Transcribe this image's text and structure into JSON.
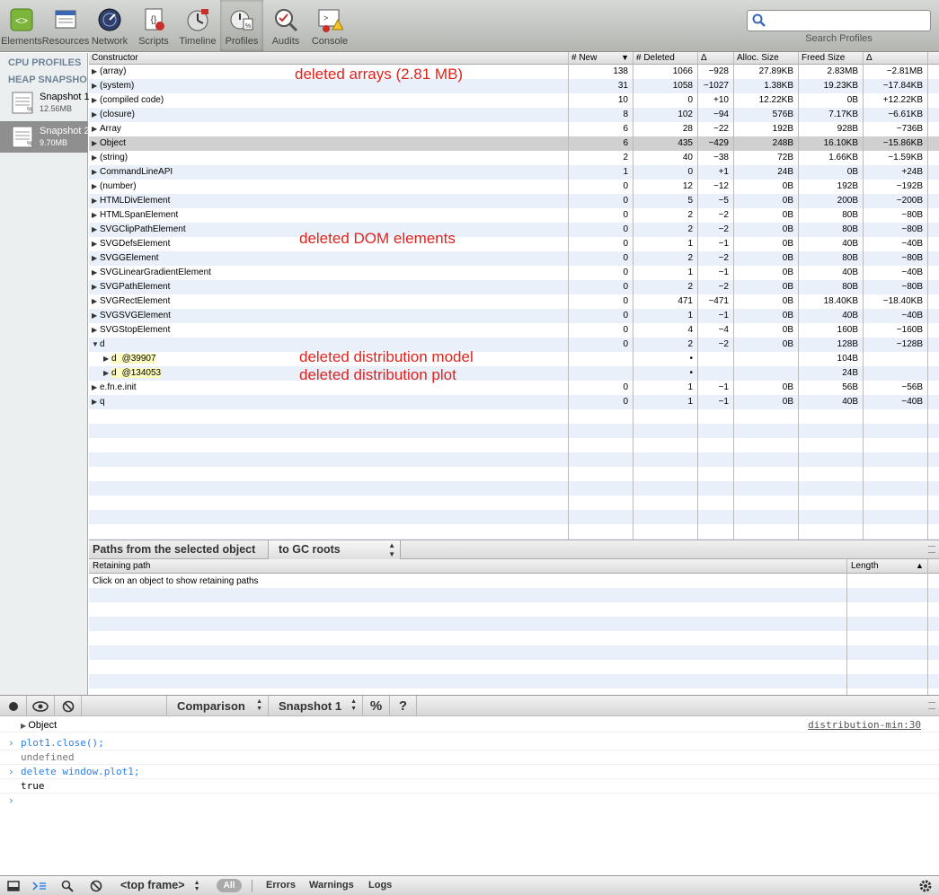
{
  "toolbar": {
    "items": [
      {
        "label": "Elements",
        "icon": "elements-icon"
      },
      {
        "label": "Resources",
        "icon": "resources-icon"
      },
      {
        "label": "Network",
        "icon": "network-icon"
      },
      {
        "label": "Scripts",
        "icon": "scripts-icon"
      },
      {
        "label": "Timeline",
        "icon": "timeline-icon"
      },
      {
        "label": "Profiles",
        "icon": "profiles-icon",
        "selected": true
      },
      {
        "label": "Audits",
        "icon": "audits-icon"
      },
      {
        "label": "Console",
        "icon": "console-icon"
      }
    ],
    "search": {
      "value": "",
      "label": "Search Profiles"
    }
  },
  "sidebar": {
    "cpu_profiles": "CPU PROFILES",
    "heap_snapshots": "HEAP SNAPSHOTS",
    "snapshots": [
      {
        "title": "Snapshot 1",
        "size": "12.56MB"
      },
      {
        "title": "Snapshot 2",
        "size": "9.70MB",
        "selected": true
      }
    ]
  },
  "grid": {
    "headers": [
      "Constructor",
      "# New",
      "# Deleted",
      "Δ",
      "Alloc. Size",
      "Freed Size",
      "Δ"
    ],
    "rows": [
      {
        "name": "(array)",
        "new": "138",
        "deleted": "1066",
        "delta": "−928",
        "alloc": "27.89KB",
        "freed": "2.83MB",
        "sdelta": "−2.81MB",
        "tri": "▶"
      },
      {
        "name": "(system)",
        "new": "31",
        "deleted": "1058",
        "delta": "−1027",
        "alloc": "1.38KB",
        "freed": "19.23KB",
        "sdelta": "−17.84KB",
        "tri": "▶"
      },
      {
        "name": "(compiled code)",
        "new": "10",
        "deleted": "0",
        "delta": "+10",
        "alloc": "12.22KB",
        "freed": "0B",
        "sdelta": "+12.22KB",
        "tri": "▶"
      },
      {
        "name": "(closure)",
        "new": "8",
        "deleted": "102",
        "delta": "−94",
        "alloc": "576B",
        "freed": "7.17KB",
        "sdelta": "−6.61KB",
        "tri": "▶"
      },
      {
        "name": "Array",
        "new": "6",
        "deleted": "28",
        "delta": "−22",
        "alloc": "192B",
        "freed": "928B",
        "sdelta": "−736B",
        "tri": "▶"
      },
      {
        "name": "Object",
        "new": "6",
        "deleted": "435",
        "delta": "−429",
        "alloc": "248B",
        "freed": "16.10KB",
        "sdelta": "−15.86KB",
        "tri": "▶",
        "selected": true
      },
      {
        "name": "(string)",
        "new": "2",
        "deleted": "40",
        "delta": "−38",
        "alloc": "72B",
        "freed": "1.66KB",
        "sdelta": "−1.59KB",
        "tri": "▶"
      },
      {
        "name": "CommandLineAPI",
        "new": "1",
        "deleted": "0",
        "delta": "+1",
        "alloc": "24B",
        "freed": "0B",
        "sdelta": "+24B",
        "tri": "▶"
      },
      {
        "name": "(number)",
        "new": "0",
        "deleted": "12",
        "delta": "−12",
        "alloc": "0B",
        "freed": "192B",
        "sdelta": "−192B",
        "tri": "▶"
      },
      {
        "name": "HTMLDivElement",
        "new": "0",
        "deleted": "5",
        "delta": "−5",
        "alloc": "0B",
        "freed": "200B",
        "sdelta": "−200B",
        "tri": "▶"
      },
      {
        "name": "HTMLSpanElement",
        "new": "0",
        "deleted": "2",
        "delta": "−2",
        "alloc": "0B",
        "freed": "80B",
        "sdelta": "−80B",
        "tri": "▶"
      },
      {
        "name": "SVGClipPathElement",
        "new": "0",
        "deleted": "2",
        "delta": "−2",
        "alloc": "0B",
        "freed": "80B",
        "sdelta": "−80B",
        "tri": "▶"
      },
      {
        "name": "SVGDefsElement",
        "new": "0",
        "deleted": "1",
        "delta": "−1",
        "alloc": "0B",
        "freed": "40B",
        "sdelta": "−40B",
        "tri": "▶"
      },
      {
        "name": "SVGGElement",
        "new": "0",
        "deleted": "2",
        "delta": "−2",
        "alloc": "0B",
        "freed": "80B",
        "sdelta": "−80B",
        "tri": "▶"
      },
      {
        "name": "SVGLinearGradientElement",
        "new": "0",
        "deleted": "1",
        "delta": "−1",
        "alloc": "0B",
        "freed": "40B",
        "sdelta": "−40B",
        "tri": "▶"
      },
      {
        "name": "SVGPathElement",
        "new": "0",
        "deleted": "2",
        "delta": "−2",
        "alloc": "0B",
        "freed": "80B",
        "sdelta": "−80B",
        "tri": "▶"
      },
      {
        "name": "SVGRectElement",
        "new": "0",
        "deleted": "471",
        "delta": "−471",
        "alloc": "0B",
        "freed": "18.40KB",
        "sdelta": "−18.40KB",
        "tri": "▶"
      },
      {
        "name": "SVGSVGElement",
        "new": "0",
        "deleted": "1",
        "delta": "−1",
        "alloc": "0B",
        "freed": "40B",
        "sdelta": "−40B",
        "tri": "▶"
      },
      {
        "name": "SVGStopElement",
        "new": "0",
        "deleted": "4",
        "delta": "−4",
        "alloc": "0B",
        "freed": "160B",
        "sdelta": "−160B",
        "tri": "▶"
      },
      {
        "name": "d",
        "new": "0",
        "deleted": "2",
        "delta": "−2",
        "alloc": "0B",
        "freed": "128B",
        "sdelta": "−128B",
        "tri": "▼"
      },
      {
        "name": "d",
        "addr": "@39907",
        "new": "",
        "deleted": "•",
        "delta": "",
        "alloc": "",
        "freed": "104B",
        "sdelta": "",
        "tri": "▶",
        "child": true
      },
      {
        "name": "d",
        "addr": "@134053",
        "new": "",
        "deleted": "•",
        "delta": "",
        "alloc": "",
        "freed": "24B",
        "sdelta": "",
        "tri": "▶",
        "child": true
      },
      {
        "name": "e.fn.e.init",
        "new": "0",
        "deleted": "1",
        "delta": "−1",
        "alloc": "0B",
        "freed": "56B",
        "sdelta": "−56B",
        "tri": "▶"
      },
      {
        "name": "q",
        "new": "0",
        "deleted": "1",
        "delta": "−1",
        "alloc": "0B",
        "freed": "40B",
        "sdelta": "−40B",
        "tri": "▶"
      }
    ]
  },
  "annotations": {
    "arrays": "deleted arrays (2.81 MB)",
    "dom": "deleted DOM elements",
    "model": "deleted distribution model",
    "plot": "deleted distribution plot",
    "color": "#e0231f"
  },
  "retaining": {
    "title": "Paths from the selected object",
    "select": "to GC roots",
    "col_path": "Retaining path",
    "col_length": "Length",
    "hint": "Click on an object to show retaining paths"
  },
  "statusbar": {
    "comparison": "Comparison",
    "snapshot": "Snapshot 1",
    "percent": "%",
    "help": "?"
  },
  "console": {
    "source_link": "distribution-min:30",
    "lines": [
      {
        "prompt": "",
        "text": "Object"
      },
      {
        "prompt": "›",
        "text": "plot1.close();"
      },
      {
        "prompt": "",
        "text": "undefined"
      },
      {
        "prompt": "›",
        "text": "delete window.plot1;"
      },
      {
        "prompt": "",
        "text": "true"
      },
      {
        "prompt": "›",
        "text": ""
      }
    ]
  },
  "bottombar": {
    "frame": "<top frame>",
    "all": "All",
    "errors": "Errors",
    "warnings": "Warnings",
    "logs": "Logs"
  }
}
